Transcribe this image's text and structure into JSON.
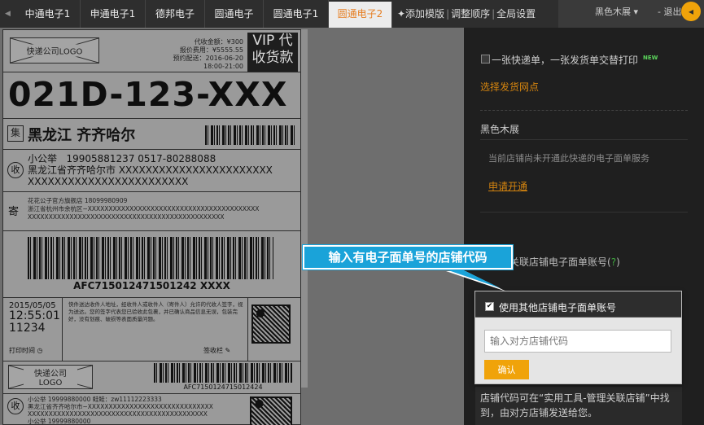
{
  "tabs": [
    {
      "label": "中通电子1",
      "active": false
    },
    {
      "label": "申通电子1",
      "active": false
    },
    {
      "label": "德邦电子",
      "active": false
    },
    {
      "label": "圆通电子",
      "active": false
    },
    {
      "label": "圆通电子1",
      "active": false
    },
    {
      "label": "圆通电子2",
      "active": true
    }
  ],
  "actions": {
    "add_template": "✦添加模版",
    "adjust_order": "调整顺序",
    "global_settings": "全局设置"
  },
  "topright": {
    "store": "黑色木展",
    "logout": "- 退出",
    "next": "◂"
  },
  "label": {
    "logo_text": "快递公司LOGO",
    "cod_amount": "代收金额：¥300",
    "insured_fee": "报价费用：¥5555.55",
    "reserve_delivery": "预约配送：2016-06-20 18:00-21:00",
    "vip_line1": "VIP 代",
    "vip_line2": "收货款",
    "big_code": "021D-123-XXX",
    "ji": "集",
    "dest_city": "黑龙江  齐齐哈尔",
    "recv_icon": "收",
    "receiver_name": "小公举",
    "receiver_phones": "19905881237   0517-80288088",
    "receiver_addr1": "黑龙江省齐齐哈尔市 XXXXXXXXXXXXXXXXXXXXXXX",
    "receiver_addr2": "XXXXXXXXXXXXXXXXXXXXXXXX",
    "send_icon": "寄",
    "sender_name": "花花公子官方旗舰店   18099980909",
    "sender_addr1": "浙江省杭州市余杭区~XXXXXXXXXXXXXXXXXXXXXXXXXXXXXXXXXXXXXXXXX",
    "sender_addr2": "XXXXXXXXXXXXXXXXXXXXXXXXXXXXXXXXXXXXXXXXXXXXXXX",
    "barcode_number": "AFC715012471501242 XXXX",
    "date": "2015/05/05",
    "time": "12:55:01",
    "serial": "11234",
    "print_time": "打印时间",
    "sign_notice": "快件送达收件人地址，经收件人或收件人（寄件人）允许的代收人签字，视为送达。您的签字代表您已验收此包裹，并已确认商品信息无误，包装完好，没有划痕、破损等表面质量问题。",
    "sign_field": "签收栏",
    "logo_text2": "快递公司LOGO",
    "barcode_number2": "AFC7150124715012424",
    "recv2_line1": "小公举    19999880000    鲑鲑：zw11112223333",
    "recv2_line2": "黑龙江省齐齐哈尔市~XXXXXXXXXXXXXXXXXXXXXXXXXXXXXX",
    "recv2_line3": "XXXXXXXXXXXXXXXXXXXXXXXXXXXXXXXXXXXXXXXXXXX",
    "recv2_line4": "小公举    19999880000"
  },
  "panel": {
    "combo_print": "一张快递单，一张发货单交替打印",
    "new_badge": "NEW",
    "select_outlet": "选择发货网点",
    "store_name": "黑色木展",
    "not_enabled": "当前店铺尚未开通此快递的电子面单服务",
    "apply_link": "申请开通",
    "related_account": "关联店铺电子面单账号",
    "related_help": "?"
  },
  "popover": {
    "use_other_label": "使用其他店铺电子面单账号",
    "checked": true,
    "input_placeholder": "输入对方店铺代码",
    "confirm": "确认"
  },
  "hint": "店铺代码可在“实用工具-管理关联店铺”中找到，由对方店铺发送给您。",
  "callout": "输入有电子面单号的店铺代码",
  "colors": {
    "accent_orange": "#f0a30a",
    "callout_blue": "#1aa3d9",
    "active_tab_text": "#e67e22"
  }
}
